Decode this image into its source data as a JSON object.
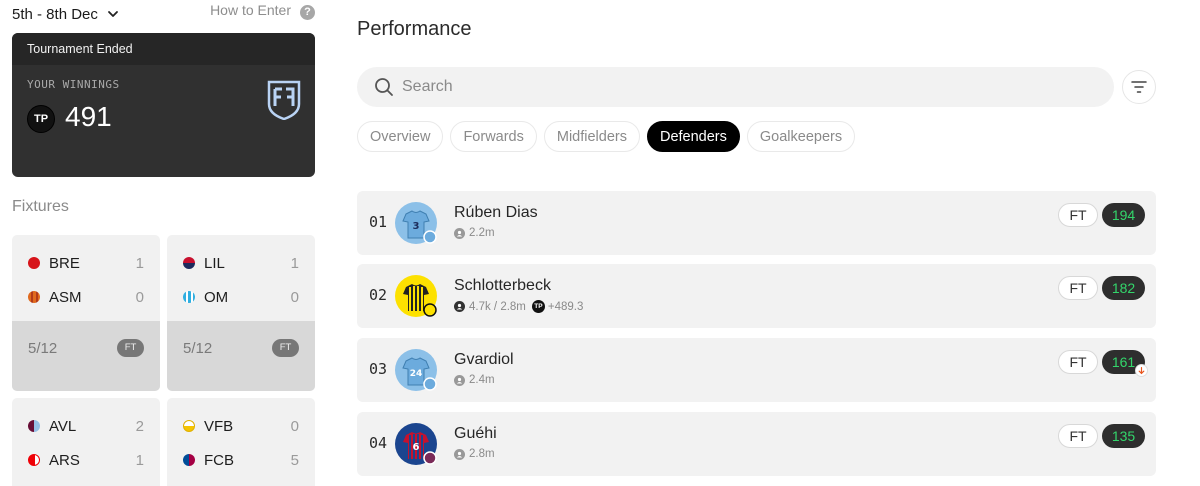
{
  "header": {
    "date_range": "5th - 8th Dec",
    "how_to_enter": "How to Enter",
    "help_glyph": "?"
  },
  "winnings": {
    "status": "Tournament Ended",
    "label": "YOUR WINNINGS",
    "currency": "TP",
    "value": "491"
  },
  "fixtures": {
    "title": "Fixtures",
    "items": [
      {
        "home": "BRE",
        "home_score": "1",
        "away": "ASM",
        "away_score": "0",
        "date": "5/12",
        "status": "FT",
        "home_color": "#d7141a",
        "away_color": "#e06a1e"
      },
      {
        "home": "LIL",
        "home_score": "1",
        "away": "OM",
        "away_score": "0",
        "date": "5/12",
        "status": "FT",
        "home_color": "#c8102e",
        "away_color": "#2faee0"
      },
      {
        "home": "AVL",
        "home_score": "2",
        "away": "ARS",
        "away_score": "1"
      },
      {
        "home": "VFB",
        "home_score": "0",
        "away": "FCB",
        "away_score": "5"
      }
    ]
  },
  "performance": {
    "title": "Performance",
    "search_placeholder": "Search",
    "tabs": [
      "Overview",
      "Forwards",
      "Midfielders",
      "Defenders",
      "Goalkeepers"
    ],
    "active_tab": "Defenders",
    "players": [
      {
        "rank": "01",
        "name": "Rúben Dias",
        "meta": "2.2m",
        "status": "FT",
        "points": "194",
        "kit": "#6cabdd",
        "shirt_no": "3"
      },
      {
        "rank": "02",
        "name": "Schlotterbeck",
        "meta": "4.7k / 2.8m",
        "tp_value": "+489.3",
        "status": "FT",
        "points": "182",
        "kit": "#fde100",
        "shirt_no": "4"
      },
      {
        "rank": "03",
        "name": "Gvardiol",
        "meta": "2.4m",
        "status": "FT",
        "points": "161",
        "kit": "#6cabdd",
        "shirt_no": "24"
      },
      {
        "rank": "04",
        "name": "Guéhi",
        "meta": "2.8m",
        "status": "FT",
        "points": "135",
        "kit": "#1b458f",
        "shirt_no": "6"
      }
    ]
  },
  "colors": {
    "points_green": "#33d66b",
    "card_dark": "#303030",
    "active_tab": "#000000"
  }
}
